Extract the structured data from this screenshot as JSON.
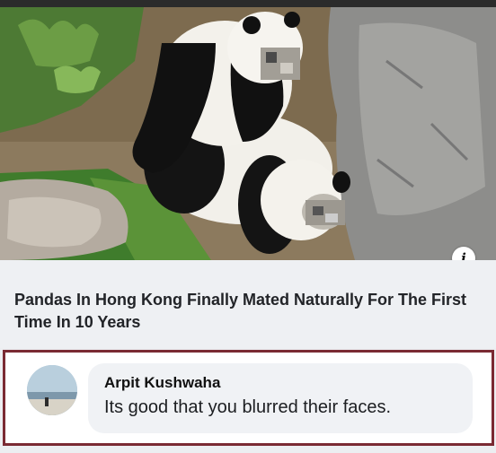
{
  "post": {
    "headline": "Pandas In Hong Kong Finally Mated Naturally For The First Time In 10 Years",
    "info_icon": "info-icon",
    "info_glyph": "i"
  },
  "comment": {
    "author": "Arpit Kushwaha",
    "text": "Its good that you blurred their faces.",
    "avatar": "profile-photo"
  },
  "colors": {
    "frame": "#7a2a33",
    "headline": "#222428",
    "bubble": "#f0f2f5"
  }
}
